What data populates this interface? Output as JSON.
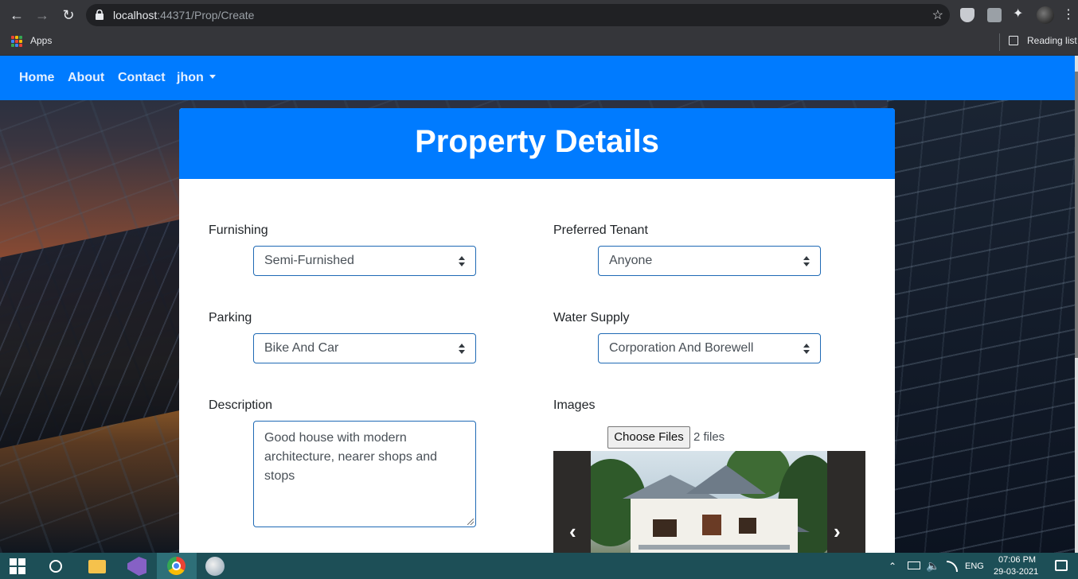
{
  "browser": {
    "url_host": "localhost",
    "url_rest": ":44371/Prop/Create",
    "bookmarks": {
      "apps_label": "Apps",
      "reading_list_label": "Reading list"
    }
  },
  "navbar": {
    "links": [
      "Home",
      "About",
      "Contact"
    ],
    "user_dropdown": "jhon",
    "color": "#007bff"
  },
  "card": {
    "title": "Property Details"
  },
  "form": {
    "furnishing": {
      "label": "Furnishing",
      "value": "Semi-Furnished"
    },
    "preferred_tenant": {
      "label": "Preferred Tenant",
      "value": "Anyone"
    },
    "parking": {
      "label": "Parking",
      "value": "Bike And Car"
    },
    "water_supply": {
      "label": "Water Supply",
      "value": "Corporation And Borewell"
    },
    "description": {
      "label": "Description",
      "value": "Good house with modern architecture, nearer shops and stops"
    },
    "images": {
      "label": "Images",
      "button": "Choose Files",
      "status": "2 files"
    }
  },
  "carousel": {
    "prev_icon": "chevron-left-icon",
    "next_icon": "chevron-right-icon"
  },
  "taskbar": {
    "language": "ENG",
    "time": "07:06 PM",
    "date": "29-03-2021"
  }
}
